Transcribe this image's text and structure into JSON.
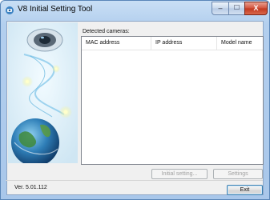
{
  "window": {
    "title": "V8 Initial Setting Tool",
    "minimize_glyph": "–",
    "maximize_glyph": "□",
    "close_glyph": "X"
  },
  "main": {
    "list_title": "Detected cameras:",
    "columns": [
      "MAC address",
      "IP address",
      "Model name"
    ],
    "rows": []
  },
  "buttons": {
    "initial_setting": "Initial setting...",
    "settings": "Settings",
    "exit": "Exit"
  },
  "footer": {
    "version": "Ver. 5.01.112"
  },
  "colors": {
    "close_button": "#c8452d",
    "artwork_bg": "#d9ecf6",
    "accent_glow": "#f3f28a"
  }
}
